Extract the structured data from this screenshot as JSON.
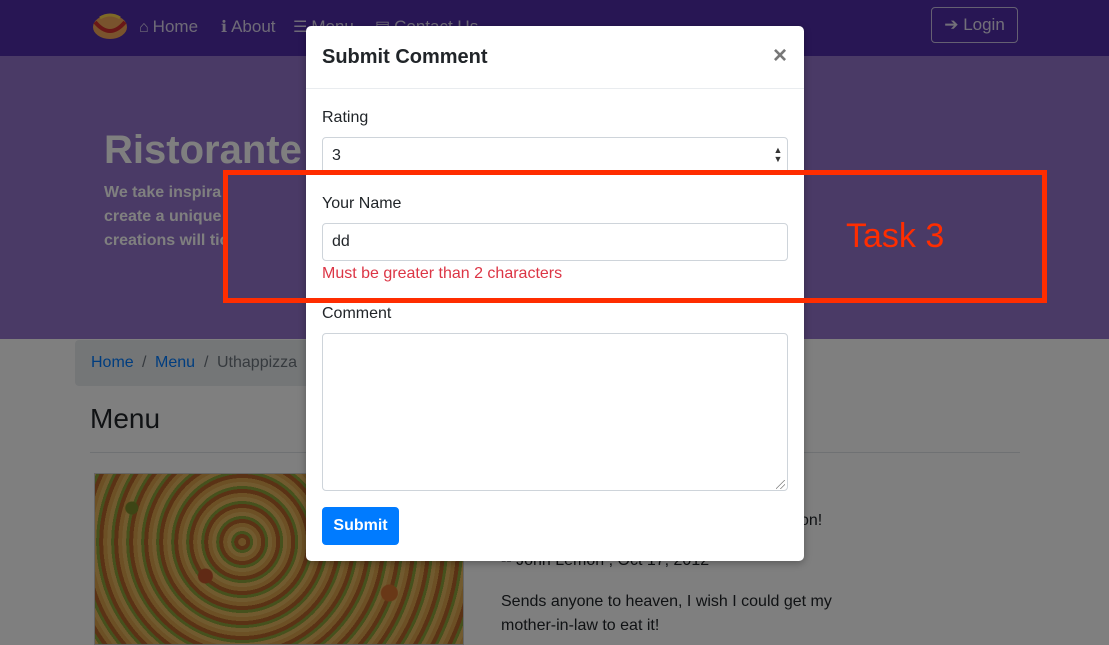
{
  "navbar": {
    "items": [
      {
        "label": "Home",
        "icon": "home-icon"
      },
      {
        "label": "About",
        "icon": "info-icon"
      },
      {
        "label": "Menu",
        "icon": "list-icon"
      },
      {
        "label": "Contact Us",
        "icon": "address-card-icon"
      }
    ],
    "login_label": "Login",
    "login_icon": "sign-in-icon",
    "color": "#512da8"
  },
  "jumbotron": {
    "title": "Ristorante c",
    "lines": [
      "We take inspira",
      "create a unique",
      "creations will tic"
    ],
    "color": "#9575cd"
  },
  "breadcrumb": {
    "home": "Home",
    "menu": "Menu",
    "active": "Uthappizza"
  },
  "page": {
    "heading": "Menu"
  },
  "comments": {
    "line1_tail": "on!",
    "author": "-- John Lemon , Oct 17, 2012",
    "line2": "Sends anyone to heaven, I wish I could get my",
    "line3": "mother-in-law to eat it!"
  },
  "modal": {
    "title": "Submit Comment",
    "close": "×",
    "rating_label": "Rating",
    "rating_value": "3",
    "name_label": "Your Name",
    "name_value": "dd",
    "name_error": "Must be greater than 2 characters",
    "comment_label": "Comment",
    "comment_value": "",
    "submit_label": "Submit",
    "error_color": "#dc3545",
    "primary_color": "#007bff"
  },
  "annotation": {
    "label": "Task 3",
    "color": "#ff2d00"
  }
}
